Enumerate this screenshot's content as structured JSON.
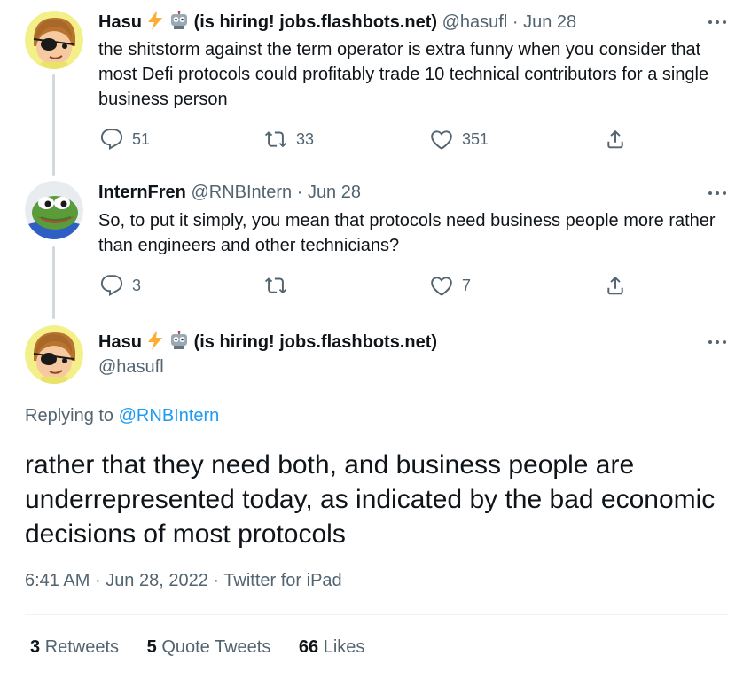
{
  "tweets": [
    {
      "name": "Hasu",
      "name_suffix": "(is hiring! jobs.flashbots.net)",
      "handle": "@hasufl",
      "sep": "·",
      "date": "Jun 28",
      "text": "the shitstorm against the term operator is extra funny when you consider that most Defi protocols could profitably trade 10 technical contributors for a single business person",
      "reply_count": "51",
      "retweet_count": "33",
      "like_count": "351"
    },
    {
      "name": "InternFren",
      "handle": "@RNBIntern",
      "sep": "·",
      "date": "Jun 28",
      "text": "So, to put it simply, you mean that protocols need business people more rather than engineers and other technicians?",
      "reply_count": "3",
      "retweet_count": "",
      "like_count": "7"
    }
  ],
  "main_tweet": {
    "name": "Hasu",
    "name_suffix": "(is hiring! jobs.flashbots.net)",
    "handle": "@hasufl",
    "replying_prefix": "Replying to",
    "replying_to": "@RNBIntern",
    "text": "rather that they need both, and business people are underrepresented today, as indicated by the bad economic decisions of most protocols",
    "time": "6:41 AM",
    "sep": "·",
    "date": "Jun 28, 2022",
    "source": "Twitter for iPad"
  },
  "stats": {
    "retweets_count": "3",
    "retweets_label": "Retweets",
    "quote_count": "5",
    "quote_label": "Quote Tweets",
    "likes_count": "66",
    "likes_label": "Likes"
  },
  "icons": {
    "more": "more-dots-icon",
    "reply": "reply-icon",
    "retweet": "retweet-icon",
    "like": "heart-icon",
    "share": "share-icon",
    "lightning": "lightning-emoji",
    "robot": "robot-emoji"
  },
  "colors": {
    "accent": "#1d9bf0",
    "secondary_text": "#536471",
    "primary_text": "#0f1419",
    "thread_line": "#cfd9de",
    "lightning": "#ffac33"
  }
}
